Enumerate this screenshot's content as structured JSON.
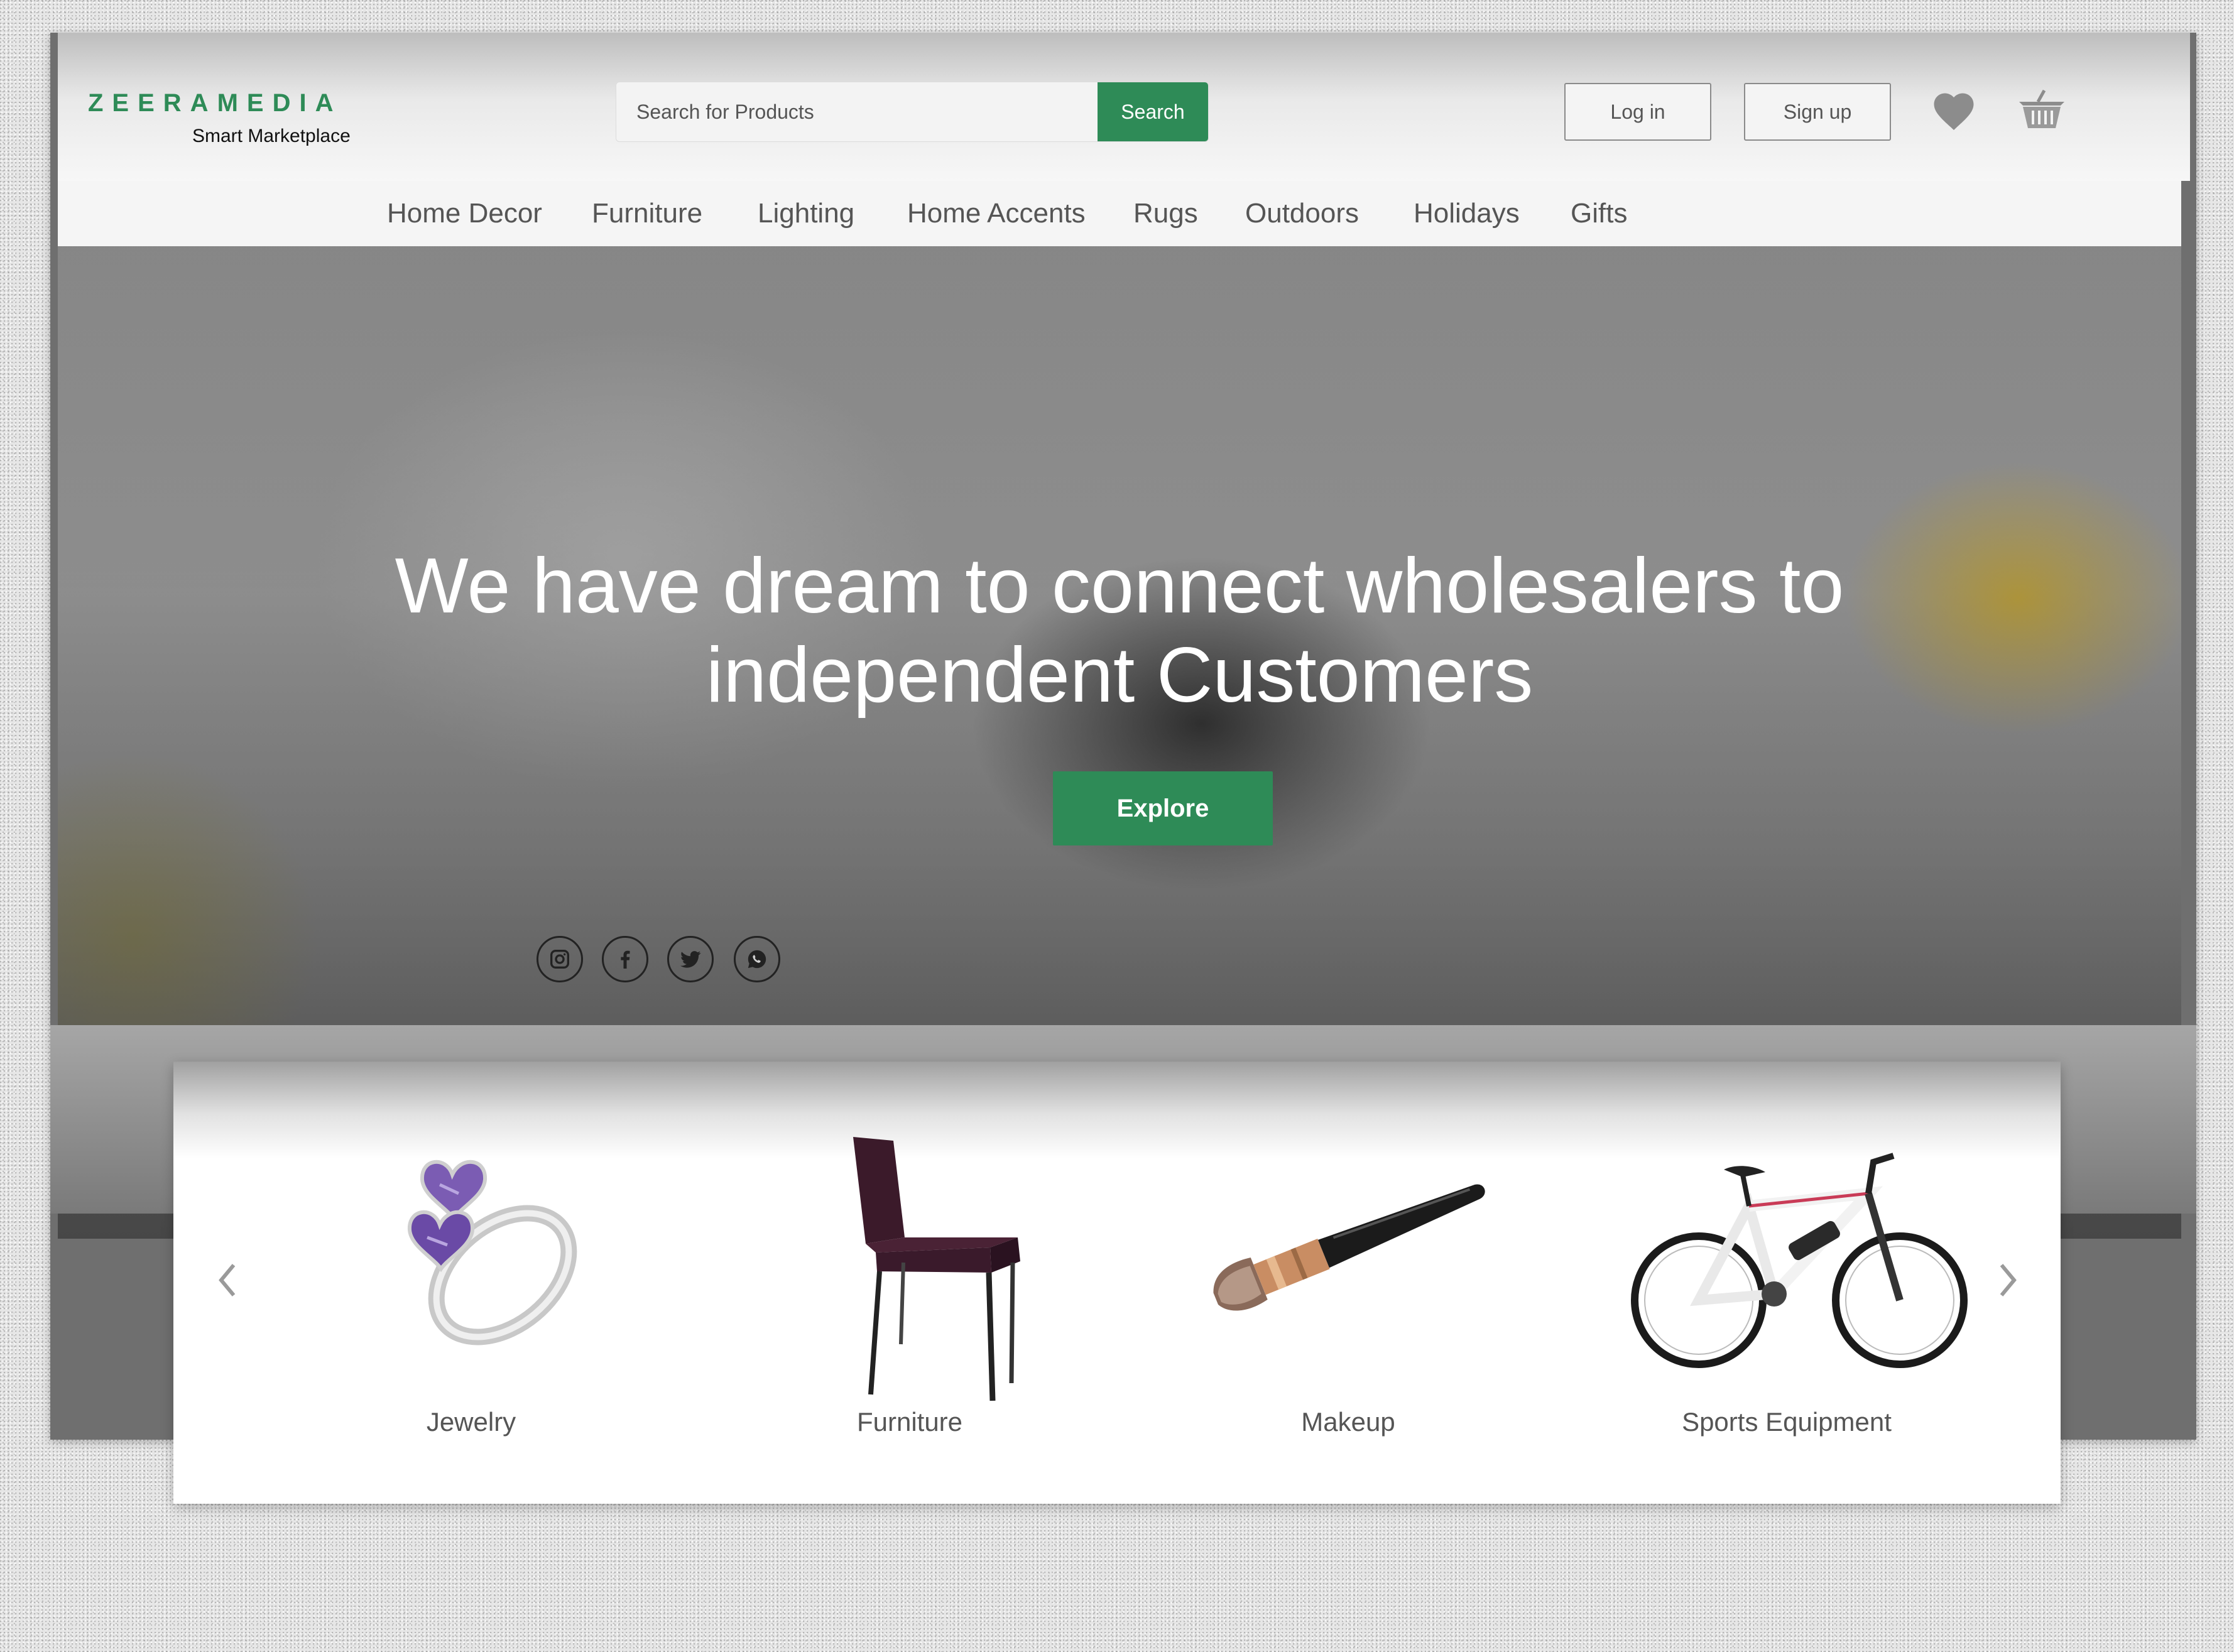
{
  "brand": {
    "name": "ZEERAMEDIA",
    "tagline": "Smart Marketplace",
    "color": "#2e8b57"
  },
  "search": {
    "placeholder": "Search for Products",
    "button_label": "Search"
  },
  "auth": {
    "login_label": "Log in",
    "signup_label": "Sign up"
  },
  "header_icons": [
    "heart-icon",
    "cart-icon"
  ],
  "nav": {
    "items": [
      "Home Decor",
      "Furniture",
      "Lighting",
      "Home Accents",
      "Rugs",
      "Outdoors",
      "Holidays",
      "Gifts"
    ]
  },
  "hero": {
    "title_line1": "We have dream to connect wholesalers to",
    "title_line2": "independent Customers",
    "cta_label": "Explore",
    "social_icons": [
      "instagram-icon",
      "facebook-icon",
      "twitter-icon",
      "whatsapp-icon"
    ]
  },
  "categories": {
    "items": [
      {
        "label": "Jewelry",
        "image": "ring-image"
      },
      {
        "label": "Furniture",
        "image": "chair-image"
      },
      {
        "label": "Makeup",
        "image": "makeup-brush-image"
      },
      {
        "label": "Sports Equipment",
        "image": "bicycle-image"
      }
    ]
  }
}
